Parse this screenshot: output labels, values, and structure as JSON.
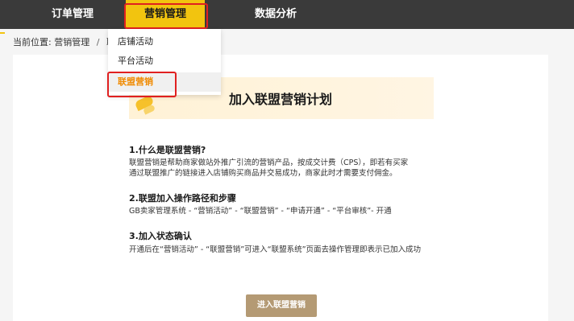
{
  "nav": {
    "orders": "订单管理",
    "marketing": "营销管理",
    "data": "数据分析"
  },
  "breadcrumb": {
    "label": "当前位置:",
    "level1": "营销管理",
    "separator": "/",
    "level2": "联盟"
  },
  "dropdown": {
    "items": [
      {
        "label": "店铺活动"
      },
      {
        "label": "平台活动"
      },
      {
        "label": "联盟营销"
      }
    ]
  },
  "banner": {
    "title": "加入联盟营销计划"
  },
  "content": {
    "s1_title": "1.什么是联盟营销?",
    "s1_line1": "联盟营销是帮助商家做站外推广引流的营销产品，按成交计费（CPS），即若有买家",
    "s1_line2": "通过联盟推广的链接进入店铺购买商品并交易成功，商家此时才需要支付佣金。",
    "s2_title": "2.联盟加入操作路径和步骤",
    "s2_line1": "GB卖家管理系统 - “营销活动” - “联盟营销” - “申请开通” - “平台审核”- 开通",
    "s3_title": "3.加入状态确认",
    "s3_line1": "开通后在“营销活动” - “联盟营销”可进入“联盟系统”页面去操作管理即表示已加入成功"
  },
  "cta": {
    "label": "进入联盟营销"
  },
  "colors": {
    "nav_bg": "#3a3a3a",
    "nav_active": "#f2c40f",
    "highlight": "#e02020",
    "active_item_text": "#f08a00",
    "button": "#b49a74"
  }
}
